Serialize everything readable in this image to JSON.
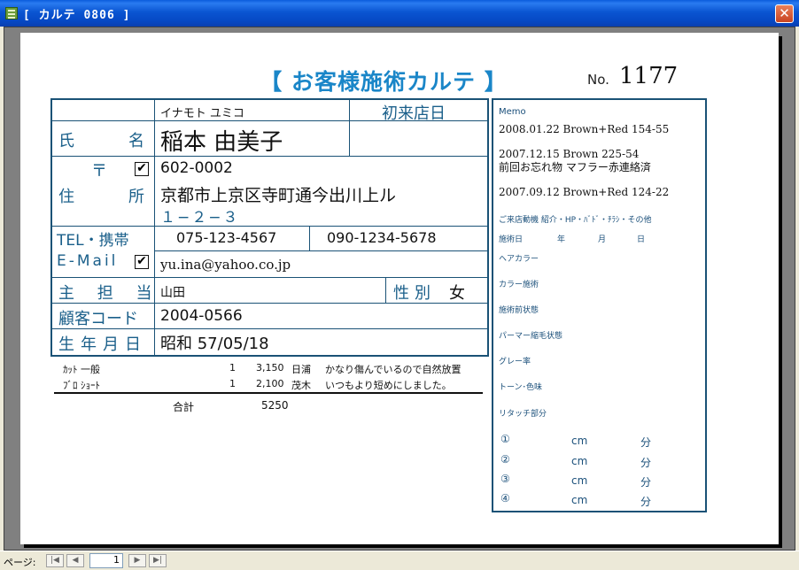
{
  "window": {
    "title": "[ カルテ 0806 ]",
    "close_glyph": "✕"
  },
  "form": {
    "title": "【 お客様施術カルテ 】",
    "no_label": "No.",
    "no_value": "1177"
  },
  "info": {
    "furigana": "イナモト ユミコ",
    "first_visit_label": "初来店日",
    "first_visit_value": "",
    "name_label_1": "氏",
    "name_label_2": "名",
    "name_value": "稲本 由美子",
    "postal_mark": "〒",
    "postal_checked": true,
    "postal_value": "602-0002",
    "address_label_1": "住",
    "address_label_2": "所",
    "address_line1": "京都市上京区寺町通今出川上ル",
    "address_line2": "１−２−３",
    "tel_label": "TEL・携帯",
    "tel_value": "075-123-4567",
    "mobile_value": "090-1234-5678",
    "email_label": "E-Mail",
    "email_checked": true,
    "email_value": "yu.ina@yahoo.co.jp",
    "staff_label": "主 担 当",
    "staff_value": "山田",
    "gender_label": "性別",
    "gender_value": "女",
    "code_label": "顧客コード",
    "code_value": "2004-0566",
    "birth_label": "生年月日",
    "birth_value": "昭和 57/05/18",
    "check_glyph": "✔"
  },
  "services": [
    {
      "name": "ｶｯﾄ 一般",
      "qty": "1",
      "price": "3,150",
      "staff": "日浦",
      "note": "かなり傷んでいるので自然放置"
    },
    {
      "name": "ﾌﾞﾛ ｼｮｰﾄ",
      "qty": "1",
      "price": "2,100",
      "staff": "茂木",
      "note": "いつもより短めにしました。"
    }
  ],
  "total": {
    "label": "合計",
    "value": "5250"
  },
  "memo": {
    "title": "Memo",
    "entries": [
      {
        "line1": "2008.01.22  Brown+Red  154-55",
        "line2": ""
      },
      {
        "line1": "2007.12.15  Brown  225-54",
        "line2": "前回お忘れ物  マフラー赤連絡済"
      },
      {
        "line1": "2007.09.12  Brown+Red  124-22",
        "line2": ""
      }
    ],
    "motive": "ご来店動機  紹介・HP・ﾊﾞﾄﾞ・ﾁﾗｼ・その他",
    "date_label": "施術日",
    "year": "年",
    "month": "月",
    "day": "日",
    "hair_color": "ヘアカラー",
    "color_treatment": "カラー施術",
    "before_state": "施術前状態",
    "perm_state": "パーマー縮毛状態",
    "gray_rate": "グレー率",
    "tone": "トーン･色味",
    "retouch": "リタッチ部分",
    "rows": [
      {
        "num": "①",
        "unit": "cm",
        "min": "分"
      },
      {
        "num": "②",
        "unit": "cm",
        "min": "分"
      },
      {
        "num": "③",
        "unit": "cm",
        "min": "分"
      },
      {
        "num": "④",
        "unit": "cm",
        "min": "分"
      }
    ]
  },
  "statusbar": {
    "page_label": "ページ:",
    "page_value": "1",
    "first": "|◀",
    "prev": "◀",
    "next": "▶",
    "last": "▶|"
  }
}
